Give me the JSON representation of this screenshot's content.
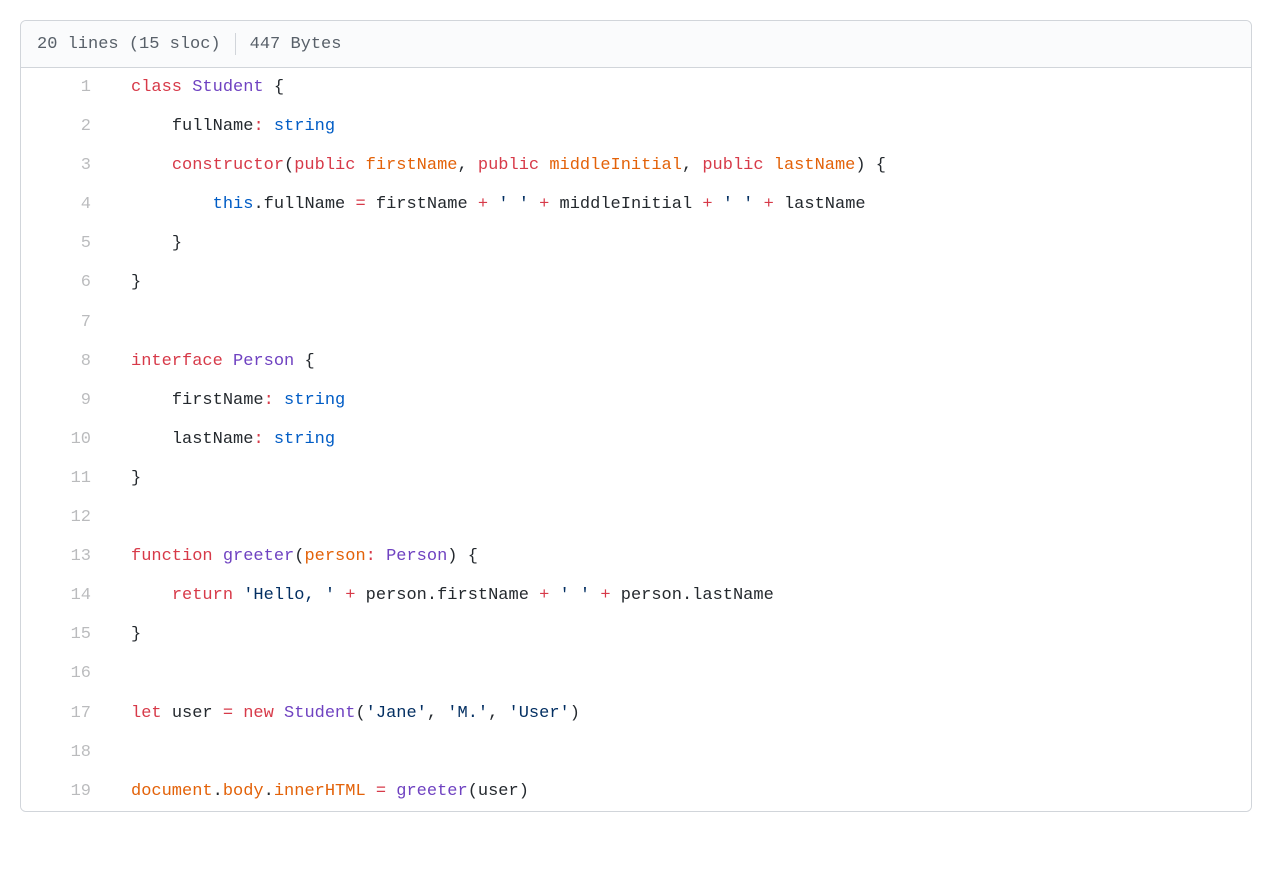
{
  "file_info": {
    "lines_sloc": "20 lines (15 sloc)",
    "size": "447 Bytes"
  },
  "code_lines": [
    {
      "n": 1,
      "i": 0,
      "t": [
        [
          "kw",
          "class"
        ],
        [
          "sp",
          " "
        ],
        [
          "cls",
          "Student"
        ],
        [
          "sp",
          " "
        ],
        [
          "punct",
          "{"
        ]
      ]
    },
    {
      "n": 2,
      "i": 1,
      "t": [
        [
          "id",
          "fullName"
        ],
        [
          "op",
          ":"
        ],
        [
          "sp",
          " "
        ],
        [
          "type",
          "string"
        ]
      ]
    },
    {
      "n": 3,
      "i": 1,
      "t": [
        [
          "kw",
          "constructor"
        ],
        [
          "punct",
          "("
        ],
        [
          "kw",
          "public"
        ],
        [
          "sp",
          " "
        ],
        [
          "prm",
          "firstName"
        ],
        [
          "punct",
          ","
        ],
        [
          "sp",
          " "
        ],
        [
          "kw",
          "public"
        ],
        [
          "sp",
          " "
        ],
        [
          "prm",
          "middleInitial"
        ],
        [
          "punct",
          ","
        ],
        [
          "sp",
          " "
        ],
        [
          "kw",
          "public"
        ],
        [
          "sp",
          " "
        ],
        [
          "prm",
          "lastName"
        ],
        [
          "punct",
          ")"
        ],
        [
          "sp",
          " "
        ],
        [
          "punct",
          "{"
        ]
      ]
    },
    {
      "n": 4,
      "i": 2,
      "t": [
        [
          "this",
          "this"
        ],
        [
          "punct",
          "."
        ],
        [
          "id",
          "fullName"
        ],
        [
          "sp",
          " "
        ],
        [
          "op",
          "="
        ],
        [
          "sp",
          " "
        ],
        [
          "id",
          "firstName"
        ],
        [
          "sp",
          " "
        ],
        [
          "op",
          "+"
        ],
        [
          "sp",
          " "
        ],
        [
          "str",
          "' '"
        ],
        [
          "sp",
          " "
        ],
        [
          "op",
          "+"
        ],
        [
          "sp",
          " "
        ],
        [
          "id",
          "middleInitial"
        ],
        [
          "sp",
          " "
        ],
        [
          "op",
          "+"
        ],
        [
          "sp",
          " "
        ],
        [
          "str",
          "' '"
        ],
        [
          "sp",
          " "
        ],
        [
          "op",
          "+"
        ],
        [
          "sp",
          " "
        ],
        [
          "id",
          "lastName"
        ]
      ]
    },
    {
      "n": 5,
      "i": 1,
      "t": [
        [
          "punct",
          "}"
        ]
      ]
    },
    {
      "n": 6,
      "i": 0,
      "t": [
        [
          "punct",
          "}"
        ]
      ]
    },
    {
      "n": 7,
      "i": 0,
      "t": []
    },
    {
      "n": 8,
      "i": 0,
      "t": [
        [
          "kw",
          "interface"
        ],
        [
          "sp",
          " "
        ],
        [
          "cls",
          "Person"
        ],
        [
          "sp",
          " "
        ],
        [
          "punct",
          "{"
        ]
      ]
    },
    {
      "n": 9,
      "i": 1,
      "t": [
        [
          "id",
          "firstName"
        ],
        [
          "op",
          ":"
        ],
        [
          "sp",
          " "
        ],
        [
          "type",
          "string"
        ]
      ]
    },
    {
      "n": 10,
      "i": 1,
      "t": [
        [
          "id",
          "lastName"
        ],
        [
          "op",
          ":"
        ],
        [
          "sp",
          " "
        ],
        [
          "type",
          "string"
        ]
      ]
    },
    {
      "n": 11,
      "i": 0,
      "t": [
        [
          "punct",
          "}"
        ]
      ]
    },
    {
      "n": 12,
      "i": 0,
      "t": []
    },
    {
      "n": 13,
      "i": 0,
      "t": [
        [
          "kw",
          "function"
        ],
        [
          "sp",
          " "
        ],
        [
          "fn",
          "greeter"
        ],
        [
          "punct",
          "("
        ],
        [
          "prm",
          "person"
        ],
        [
          "op",
          ":"
        ],
        [
          "sp",
          " "
        ],
        [
          "cls",
          "Person"
        ],
        [
          "punct",
          ")"
        ],
        [
          "sp",
          " "
        ],
        [
          "punct",
          "{"
        ]
      ]
    },
    {
      "n": 14,
      "i": 1,
      "t": [
        [
          "kw",
          "return"
        ],
        [
          "sp",
          " "
        ],
        [
          "str",
          "'Hello, '"
        ],
        [
          "sp",
          " "
        ],
        [
          "op",
          "+"
        ],
        [
          "sp",
          " "
        ],
        [
          "id",
          "person"
        ],
        [
          "punct",
          "."
        ],
        [
          "id",
          "firstName"
        ],
        [
          "sp",
          " "
        ],
        [
          "op",
          "+"
        ],
        [
          "sp",
          " "
        ],
        [
          "str",
          "' '"
        ],
        [
          "sp",
          " "
        ],
        [
          "op",
          "+"
        ],
        [
          "sp",
          " "
        ],
        [
          "id",
          "person"
        ],
        [
          "punct",
          "."
        ],
        [
          "id",
          "lastName"
        ]
      ]
    },
    {
      "n": 15,
      "i": 0,
      "t": [
        [
          "punct",
          "}"
        ]
      ]
    },
    {
      "n": 16,
      "i": 0,
      "t": []
    },
    {
      "n": 17,
      "i": 0,
      "t": [
        [
          "kw",
          "let"
        ],
        [
          "sp",
          " "
        ],
        [
          "id",
          "user"
        ],
        [
          "sp",
          " "
        ],
        [
          "op",
          "="
        ],
        [
          "sp",
          " "
        ],
        [
          "kw",
          "new"
        ],
        [
          "sp",
          " "
        ],
        [
          "cls",
          "Student"
        ],
        [
          "punct",
          "("
        ],
        [
          "str",
          "'Jane'"
        ],
        [
          "punct",
          ","
        ],
        [
          "sp",
          " "
        ],
        [
          "str",
          "'M.'"
        ],
        [
          "punct",
          ","
        ],
        [
          "sp",
          " "
        ],
        [
          "str",
          "'User'"
        ],
        [
          "punct",
          ")"
        ]
      ]
    },
    {
      "n": 18,
      "i": 0,
      "t": []
    },
    {
      "n": 19,
      "i": 0,
      "t": [
        [
          "var",
          "document"
        ],
        [
          "punct",
          "."
        ],
        [
          "var",
          "body"
        ],
        [
          "punct",
          "."
        ],
        [
          "var",
          "innerHTML"
        ],
        [
          "sp",
          " "
        ],
        [
          "op",
          "="
        ],
        [
          "sp",
          " "
        ],
        [
          "fn",
          "greeter"
        ],
        [
          "punct",
          "("
        ],
        [
          "id",
          "user"
        ],
        [
          "punct",
          ")"
        ]
      ]
    }
  ]
}
